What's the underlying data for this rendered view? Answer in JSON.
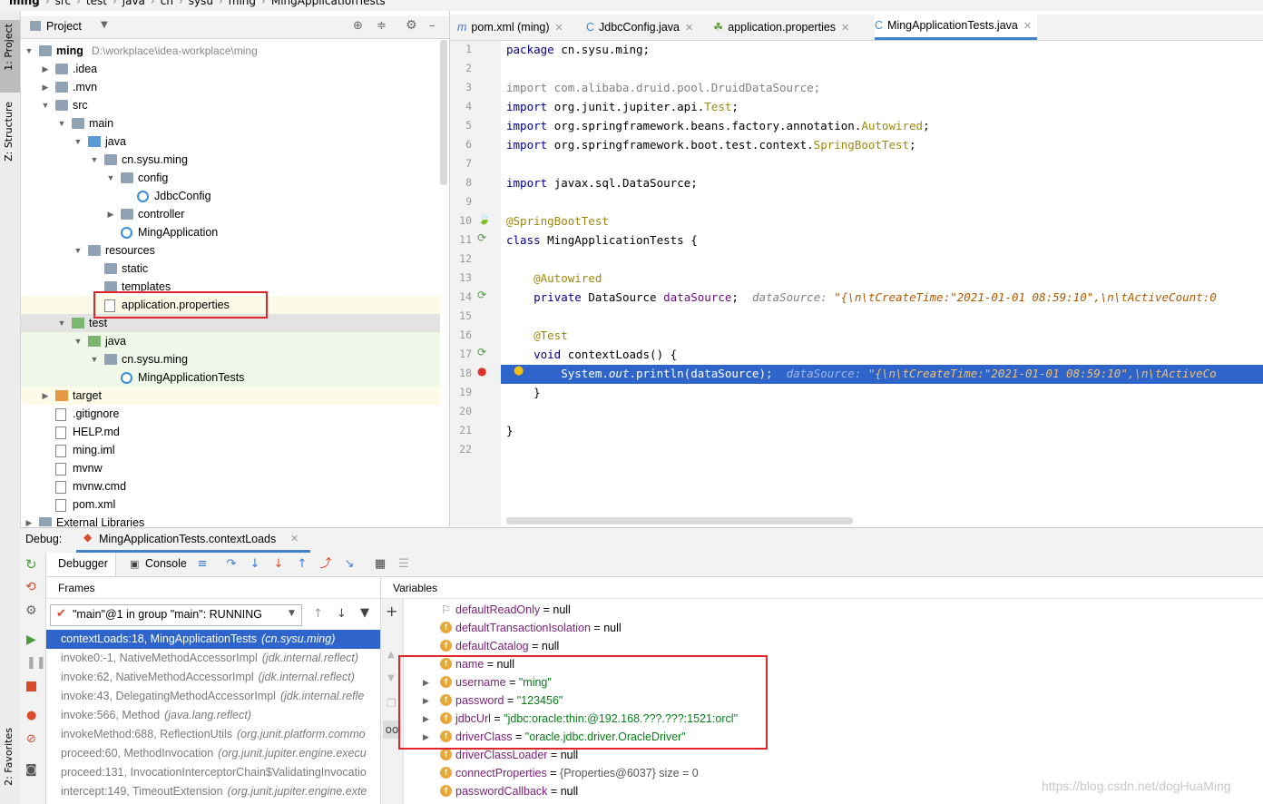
{
  "breadcrumb": [
    "ming",
    "src",
    "test",
    "java",
    "cn",
    "sysu",
    "ming",
    "MingApplicationTests"
  ],
  "left_strip": {
    "project_tab": "1: Project",
    "structure_tab": "Z: Structure",
    "favorites_tab": "2: Favorites"
  },
  "project_panel": {
    "title": "Project",
    "tree": [
      {
        "label": "ming",
        "extra": "D:\\workplace\\idea-workplace\\ming"
      },
      {
        "label": ".idea"
      },
      {
        "label": ".mvn"
      },
      {
        "label": "src"
      },
      {
        "label": "main"
      },
      {
        "label": "java"
      },
      {
        "label": "cn.sysu.ming"
      },
      {
        "label": "config"
      },
      {
        "label": "JdbcConfig"
      },
      {
        "label": "controller"
      },
      {
        "label": "MingApplication"
      },
      {
        "label": "resources"
      },
      {
        "label": "static"
      },
      {
        "label": "templates"
      },
      {
        "label": "application.properties"
      },
      {
        "label": "test"
      },
      {
        "label": "java"
      },
      {
        "label": "cn.sysu.ming"
      },
      {
        "label": "MingApplicationTests"
      },
      {
        "label": "target"
      },
      {
        "label": ".gitignore"
      },
      {
        "label": "HELP.md"
      },
      {
        "label": "ming.iml"
      },
      {
        "label": "mvnw"
      },
      {
        "label": "mvnw.cmd"
      },
      {
        "label": "pom.xml"
      },
      {
        "label": "External Libraries"
      }
    ]
  },
  "editor": {
    "tabs": [
      {
        "label": "pom.xml (ming)"
      },
      {
        "label": "JdbcConfig.java"
      },
      {
        "label": "application.properties"
      },
      {
        "label": "MingApplicationTests.java"
      }
    ],
    "lines": [
      {
        "n": "1",
        "parts": [
          [
            "kw",
            "package "
          ],
          [
            "",
            "cn.sysu.ming;"
          ]
        ]
      },
      {
        "n": "2",
        "parts": []
      },
      {
        "n": "3",
        "parts": [
          [
            "grey",
            "import com.alibaba.druid.pool.DruidDataSource;"
          ]
        ]
      },
      {
        "n": "4",
        "parts": [
          [
            "kw",
            "import "
          ],
          [
            "",
            "org.junit.jupiter.api."
          ],
          [
            "an",
            "Test"
          ],
          [
            "",
            ";"
          ]
        ]
      },
      {
        "n": "5",
        "parts": [
          [
            "kw",
            "import "
          ],
          [
            "",
            "org.springframework.beans.factory.annotation."
          ],
          [
            "an",
            "Autowired"
          ],
          [
            "",
            ";"
          ]
        ]
      },
      {
        "n": "6",
        "parts": [
          [
            "kw",
            "import "
          ],
          [
            "",
            "org.springframework.boot.test.context."
          ],
          [
            "an",
            "SpringBootTest"
          ],
          [
            "",
            ";"
          ]
        ]
      },
      {
        "n": "7",
        "parts": []
      },
      {
        "n": "8",
        "parts": [
          [
            "kw",
            "import "
          ],
          [
            "",
            "javax.sql.DataSource;"
          ]
        ]
      },
      {
        "n": "9",
        "parts": []
      },
      {
        "n": "10",
        "parts": [
          [
            "an",
            "@SpringBootTest"
          ]
        ]
      },
      {
        "n": "11",
        "parts": [
          [
            "kw",
            "class "
          ],
          [
            "",
            "MingApplicationTests {"
          ]
        ]
      },
      {
        "n": "12",
        "parts": []
      },
      {
        "n": "13",
        "parts": [
          [
            "",
            "    "
          ],
          [
            "an",
            "@Autowired"
          ]
        ]
      },
      {
        "n": "14",
        "parts": [
          [
            "",
            "    "
          ],
          [
            "kw",
            "private "
          ],
          [
            "",
            "DataSource "
          ],
          [
            "fld",
            "dataSource"
          ],
          [
            "",
            ";  "
          ],
          [
            "hint",
            "dataSource: "
          ],
          [
            "hintv",
            "\"{\\n\\tCreateTime:\"2021-01-01 08:59:10\",\\n\\tActiveCount:0"
          ]
        ]
      },
      {
        "n": "15",
        "parts": []
      },
      {
        "n": "16",
        "parts": [
          [
            "",
            "    "
          ],
          [
            "an",
            "@Test"
          ]
        ]
      },
      {
        "n": "17",
        "parts": [
          [
            "",
            "    "
          ],
          [
            "kw",
            "void "
          ],
          [
            "",
            "contextLoads() {"
          ]
        ]
      },
      {
        "n": "18",
        "parts": [
          [
            "",
            "        System."
          ],
          [
            "",
            "out"
          ],
          [
            "",
            ".println(dataSource);  "
          ],
          [
            "hint",
            "dataSource: "
          ],
          [
            "hintv",
            "\"{\\n\\tCreateTime:\"2021-01-01 08:59:10\",\\n\\tActiveCo"
          ]
        ]
      },
      {
        "n": "19",
        "parts": [
          [
            "",
            "    }"
          ]
        ]
      },
      {
        "n": "20",
        "parts": []
      },
      {
        "n": "21",
        "parts": [
          [
            "",
            "}"
          ]
        ]
      },
      {
        "n": "22",
        "parts": []
      }
    ]
  },
  "debug": {
    "label": "Debug:",
    "session": "MingApplicationTests.contextLoads",
    "tabs": {
      "debugger": "Debugger",
      "console": "Console"
    },
    "frames_title": "Frames",
    "variables_title": "Variables",
    "thread": "\"main\"@1 in group \"main\": RUNNING",
    "frames": [
      {
        "method": "contextLoads:18, MingApplicationTests",
        "pkg": "(cn.sysu.ming)"
      },
      {
        "method": "invoke0:-1, NativeMethodAccessorImpl",
        "pkg": "(jdk.internal.reflect)"
      },
      {
        "method": "invoke:62, NativeMethodAccessorImpl",
        "pkg": "(jdk.internal.reflect)"
      },
      {
        "method": "invoke:43, DelegatingMethodAccessorImpl",
        "pkg": "(jdk.internal.refle"
      },
      {
        "method": "invoke:566, Method",
        "pkg": "(java.lang.reflect)"
      },
      {
        "method": "invokeMethod:688, ReflectionUtils",
        "pkg": "(org.junit.platform.commo"
      },
      {
        "method": "proceed:60, MethodInvocation",
        "pkg": "(org.junit.jupiter.engine.execu"
      },
      {
        "method": "proceed:131, InvocationInterceptorChain$ValidatingInvocatio",
        "pkg": ""
      },
      {
        "method": "intercept:149, TimeoutExtension",
        "pkg": "(org.junit.jupiter.engine.exte"
      }
    ],
    "variables": [
      {
        "name": "defaultReadOnly",
        "value": "null",
        "expandable": false,
        "badge": "flag"
      },
      {
        "name": "defaultTransactionIsolation",
        "value": "null",
        "expandable": false,
        "badge": "f"
      },
      {
        "name": "defaultCatalog",
        "value": "null",
        "expandable": false,
        "badge": "f"
      },
      {
        "name": "name",
        "value": "null",
        "expandable": false,
        "badge": "f"
      },
      {
        "name": "username",
        "value": "\"ming\"",
        "expandable": true,
        "badge": "f"
      },
      {
        "name": "password",
        "value": "\"123456\"",
        "expandable": true,
        "badge": "f"
      },
      {
        "name": "jdbcUrl",
        "value": "\"jdbc:oracle:thin:@192.168.???.???:1521:orcl\"",
        "expandable": true,
        "badge": "f"
      },
      {
        "name": "driverClass",
        "value": "\"oracle.jdbc.driver.OracleDriver\"",
        "expandable": true,
        "badge": "f"
      },
      {
        "name": "driverClassLoader",
        "value": "null",
        "expandable": false,
        "badge": "f"
      },
      {
        "name": "connectProperties",
        "value": "{Properties@6037}  size = 0",
        "expandable": false,
        "badge": "f"
      },
      {
        "name": "passwordCallback",
        "value": "null",
        "expandable": false,
        "badge": "f"
      }
    ],
    "watermark": "https://blog.csdn.net/dogHuaMing"
  },
  "colors": {
    "selection": "#2f65ca",
    "highlight_box": "#e0262b",
    "test_bg": "#eff7e8",
    "resources_bg": "#fbfbe7"
  }
}
